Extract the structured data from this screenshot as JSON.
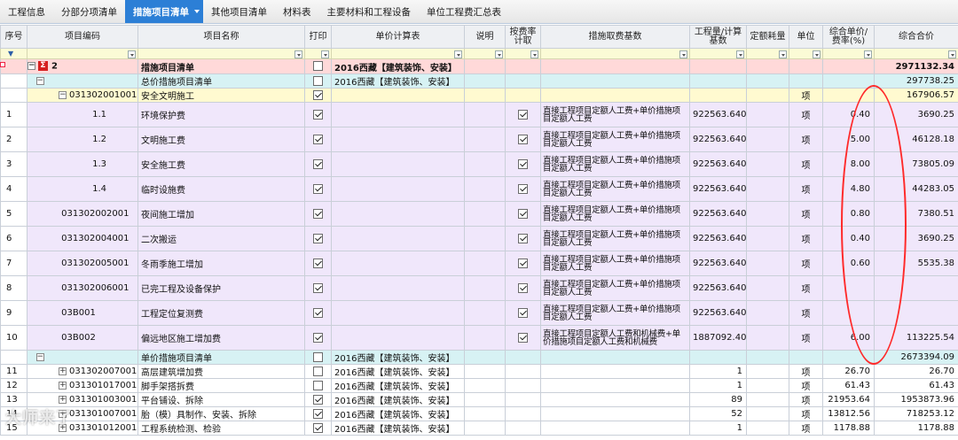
{
  "tabs": [
    {
      "label": "工程信息"
    },
    {
      "label": "分部分项清单"
    },
    {
      "label": "措施项目清单"
    },
    {
      "label": "其他项目清单"
    },
    {
      "label": "材料表"
    },
    {
      "label": "主要材料和工程设备"
    },
    {
      "label": "单位工程费汇总表"
    }
  ],
  "active_tab_index": 2,
  "columns": {
    "seq": "序号",
    "code": "项目编码",
    "name": "项目名称",
    "print": "打印",
    "calc_table": "单价计算表",
    "note": "说明",
    "by_rate": "按费率计取",
    "basis": "措施取费基数",
    "qty": "工程量/计算基数",
    "quota": "定额耗量",
    "unit": "单位",
    "rate": "综合单价/费率(%)",
    "total": "综合合价"
  },
  "filter_icon": "funnel-icon",
  "rows": {
    "r0": {
      "seq": "",
      "code": "2",
      "name": "措施项目清单",
      "calc": "2016西藏【建筑装饰、安装】",
      "total": "2971132.34"
    },
    "r1": {
      "name": "总价措施项目清单",
      "calc": "2016西藏【建筑装饰、安装】",
      "total": "297738.25"
    },
    "r2": {
      "code": "031302001001",
      "name": "安全文明施工",
      "unit": "项",
      "total": "167906.57"
    },
    "r3": {
      "seq": "1",
      "code": "1.1",
      "name": "环境保护费",
      "basis": "直接工程项目定额人工费+单价措施项目定额人工费",
      "qty": "922563.640",
      "unit": "项",
      "rate": "0.40",
      "total": "3690.25"
    },
    "r4": {
      "seq": "2",
      "code": "1.2",
      "name": "文明施工费",
      "basis": "直接工程项目定额人工费+单价措施项目定额人工费",
      "qty": "922563.640",
      "unit": "项",
      "rate": "5.00",
      "total": "46128.18"
    },
    "r5": {
      "seq": "3",
      "code": "1.3",
      "name": "安全施工费",
      "basis": "直接工程项目定额人工费+单价措施项目定额人工费",
      "qty": "922563.640",
      "unit": "项",
      "rate": "8.00",
      "total": "73805.09"
    },
    "r6": {
      "seq": "4",
      "code": "1.4",
      "name": "临时设施费",
      "basis": "直接工程项目定额人工费+单价措施项目定额人工费",
      "qty": "922563.640",
      "unit": "项",
      "rate": "4.80",
      "total": "44283.05"
    },
    "r7": {
      "seq": "5",
      "code": "031302002001",
      "name": "夜间施工增加",
      "basis": "直接工程项目定额人工费+单价措施项目定额人工费",
      "qty": "922563.640",
      "unit": "项",
      "rate": "0.80",
      "total": "7380.51"
    },
    "r8": {
      "seq": "6",
      "code": "031302004001",
      "name": "二次搬运",
      "basis": "直接工程项目定额人工费+单价措施项目定额人工费",
      "qty": "922563.640",
      "unit": "项",
      "rate": "0.40",
      "total": "3690.25"
    },
    "r9": {
      "seq": "7",
      "code": "031302005001",
      "name": "冬雨季施工增加",
      "basis": "直接工程项目定额人工费+单价措施项目定额人工费",
      "qty": "922563.640",
      "unit": "项",
      "rate": "0.60",
      "total": "5535.38"
    },
    "r10": {
      "seq": "8",
      "code": "031302006001",
      "name": "已完工程及设备保护",
      "basis": "直接工程项目定额人工费+单价措施项目定额人工费",
      "qty": "922563.640",
      "unit": "项",
      "rate": "",
      "total": ""
    },
    "r11": {
      "seq": "9",
      "code": "03B001",
      "name": "工程定位复测费",
      "basis": "直接工程项目定额人工费+单价措施项目定额人工费",
      "qty": "922563.640",
      "unit": "项",
      "rate": "",
      "total": ""
    },
    "r12": {
      "seq": "10",
      "code": "03B002",
      "name": "偏远地区施工增加费",
      "basis": "直接工程项目定额人工费和机械费+单价措施项目定额人工费和机械费",
      "qty": "1887092.400",
      "unit": "项",
      "rate": "6.00",
      "total": "113225.54"
    },
    "r13": {
      "name": "单价措施项目清单",
      "calc": "2016西藏【建筑装饰、安装】",
      "total": "2673394.09"
    },
    "r14": {
      "seq": "11",
      "code": "031302007001",
      "name": "高层建筑增加费",
      "calc": "2016西藏【建筑装饰、安装】",
      "qty": "1",
      "unit": "项",
      "rate": "26.70",
      "total": "26.70"
    },
    "r15": {
      "seq": "12",
      "code": "031301017001",
      "name": "脚手架搭拆费",
      "calc": "2016西藏【建筑装饰、安装】",
      "qty": "1",
      "unit": "项",
      "rate": "61.43",
      "total": "61.43"
    },
    "r16": {
      "seq": "13",
      "code": "031301003001",
      "name": "平台铺设、拆除",
      "calc": "2016西藏【建筑装饰、安装】",
      "qty": "89",
      "unit": "项",
      "rate": "21953.64",
      "total": "1953873.96"
    },
    "r17": {
      "seq": "14",
      "code": "031301007001",
      "name": "胎（模）具制作、安装、拆除",
      "calc": "2016西藏【建筑装饰、安装】",
      "qty": "52",
      "unit": "项",
      "rate": "13812.56",
      "total": "718253.12"
    },
    "r18": {
      "seq": "15",
      "code": "031301012001",
      "name": "工程系统检测、检验",
      "calc": "2016西藏【建筑装饰、安装】",
      "qty": "1",
      "unit": "项",
      "rate": "1178.88",
      "total": "1178.88"
    }
  },
  "watermark": "大师来了",
  "annotation_color": "#ff2a2a"
}
